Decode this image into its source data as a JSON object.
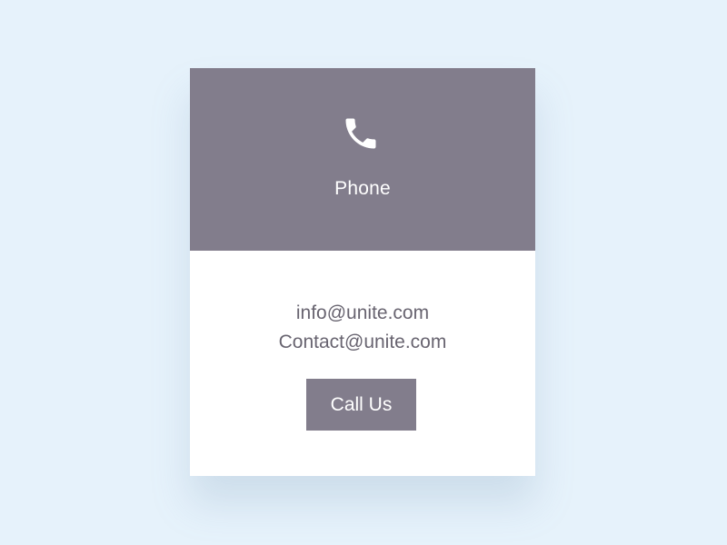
{
  "card": {
    "header": {
      "icon": "phone-icon",
      "label": "Phone"
    },
    "emails": [
      "info@unite.com",
      "Contact@unite.com"
    ],
    "button_label": "Call Us"
  },
  "colors": {
    "page_background": "#e6f2fb",
    "accent": "#827d8c",
    "card_background": "#ffffff",
    "body_text": "#686470",
    "header_text": "#ffffff"
  }
}
